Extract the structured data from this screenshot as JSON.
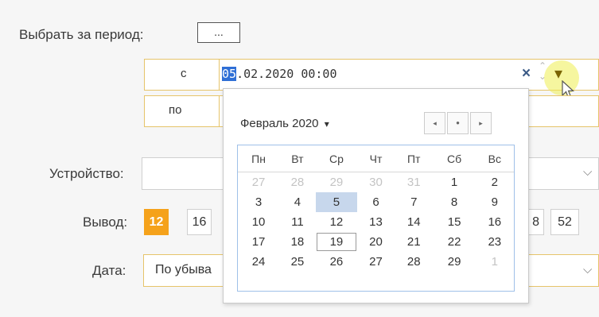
{
  "period": {
    "label": "Выбрать за период:",
    "ellipsis_label": "...",
    "from_label": "с",
    "to_label": "по",
    "from_day": "05",
    "from_rest": ".02.2020 00:00",
    "clear_glyph": "×",
    "spin_glyph": "⌃",
    "dropdown_glyph": "▾"
  },
  "device": {
    "label": "Устройство:",
    "value": "",
    "arrow": "⌵"
  },
  "output": {
    "label": "Вывод:",
    "left_options": [
      "12",
      "16"
    ],
    "right_options": [
      "8",
      "52"
    ],
    "active": "12"
  },
  "date": {
    "label": "Дата:",
    "value": "По убыва",
    "arrow": "⌵"
  },
  "calendar": {
    "month_label": "Февраль 2020",
    "month_caret": "▾",
    "nav_prev": "◂",
    "nav_today": "●",
    "nav_next": "▸",
    "weekdays": [
      "Пн",
      "Вт",
      "Ср",
      "Чт",
      "Пт",
      "Сб",
      "Вс"
    ],
    "weeks": [
      [
        "27",
        "28",
        "29",
        "30",
        "31",
        "1",
        "2"
      ],
      [
        "3",
        "4",
        "5",
        "6",
        "7",
        "8",
        "9"
      ],
      [
        "10",
        "11",
        "12",
        "13",
        "14",
        "15",
        "16"
      ],
      [
        "17",
        "18",
        "19",
        "20",
        "21",
        "22",
        "23"
      ],
      [
        "24",
        "25",
        "26",
        "27",
        "28",
        "29",
        "1"
      ]
    ],
    "selected_day": "5",
    "today_day": "19"
  },
  "colors": {
    "accent": "#f5a21b",
    "field_border": "#e6c46a",
    "selection": "#2f6fd6",
    "calendar_border": "#9fc0e8"
  }
}
